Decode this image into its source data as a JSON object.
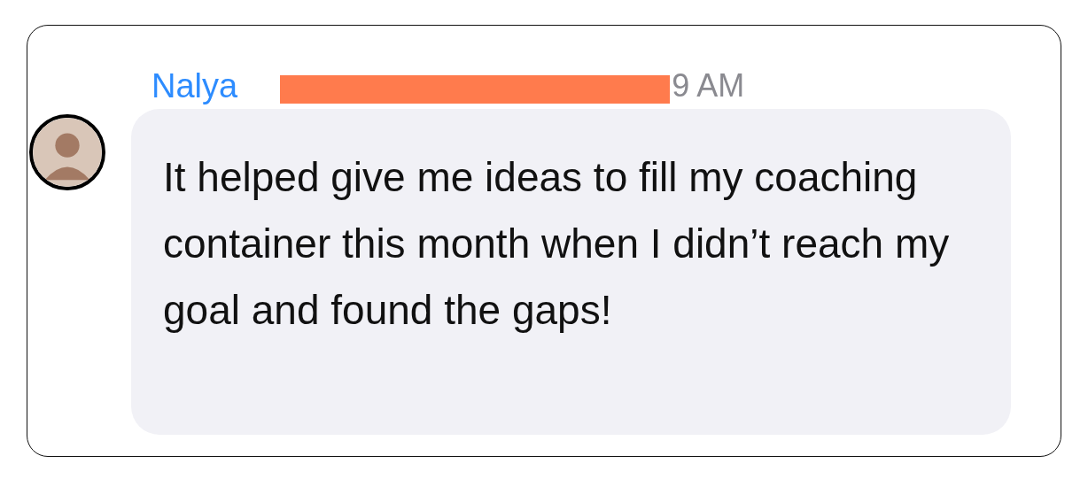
{
  "message": {
    "author": "Nalya",
    "time": "9 AM",
    "redacted": true,
    "text": "It helped give me ideas to fill my coaching container this month when I didn’t reach my goal and found the gaps!"
  }
}
